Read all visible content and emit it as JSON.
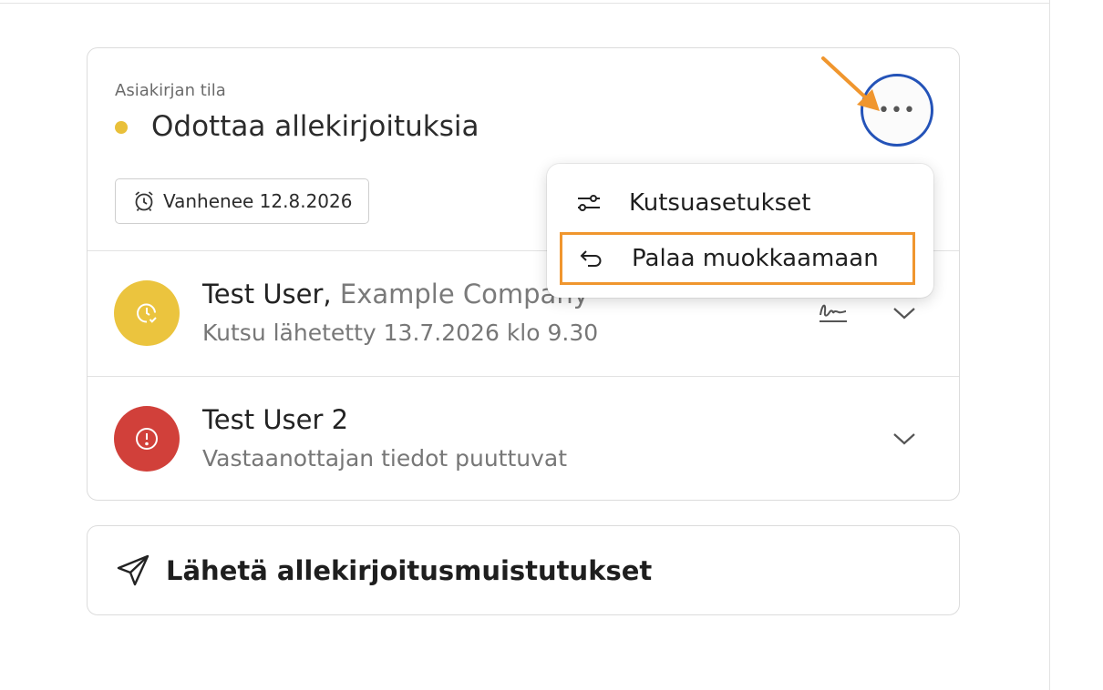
{
  "document_status": {
    "label": "Asiakirjan tila",
    "status_text": "Odottaa allekirjoituksia",
    "status_color": "#e9c03a",
    "expiry_text": "Vanhenee 12.8.2026",
    "more_button_label": "•••"
  },
  "menu": {
    "items": [
      {
        "label": "Kutsuasetukset",
        "icon": "sliders-icon"
      },
      {
        "label": "Palaa muokkaamaan",
        "icon": "undo-arrow-icon",
        "highlighted": true
      }
    ],
    "highlight_color": "#f0962e"
  },
  "recipients": [
    {
      "name": "Test User,",
      "company": "Example Company",
      "subtitle": "Kutsu lähetetty 13.7.2026 klo 9.30",
      "status_icon": "clock-check-icon",
      "status_color": "#ebc43e"
    },
    {
      "name": "Test User 2",
      "company": "",
      "subtitle": "Vastaanottajan tiedot puuttuvat",
      "status_icon": "alert-circle-icon",
      "status_color": "#d1403a"
    }
  ],
  "reminder": {
    "label": "Lähetä allekirjoitusmuistutukset",
    "icon": "send-icon"
  },
  "colors": {
    "callout_arrow": "#f0962e",
    "focus_ring": "#2453b8"
  }
}
